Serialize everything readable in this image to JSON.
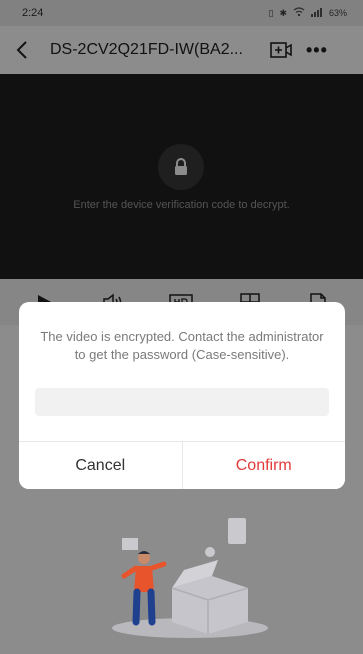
{
  "status_bar": {
    "time": "2:24",
    "icons": [
      "vibrate-icon",
      "bluetooth-icon",
      "wifi-icon",
      "signal-icon"
    ],
    "battery": "63%"
  },
  "header": {
    "title": "DS-2CV2Q21FD-IW(BA2...",
    "back_icon": "chevron-left-icon",
    "action_icon": "add-view-icon",
    "more_label": "•••"
  },
  "video": {
    "lock_icon": "lock-icon",
    "message": "Enter the device verification code to decrypt."
  },
  "toolbar": {
    "icons": [
      "play-icon",
      "volume-icon",
      "hd-icon",
      "grid-icon",
      "share-icon"
    ]
  },
  "dialog": {
    "message": "The video is encrypted. Contact the administrator to get the password (Case-sensitive).",
    "input_value": "",
    "input_placeholder": "",
    "cancel_label": "Cancel",
    "confirm_label": "Confirm"
  },
  "colors": {
    "accent_red": "#e23a3a",
    "video_bg": "#1f1f1f",
    "illustration_blue": "#1f3f8f",
    "illustration_orange": "#e8542b"
  }
}
